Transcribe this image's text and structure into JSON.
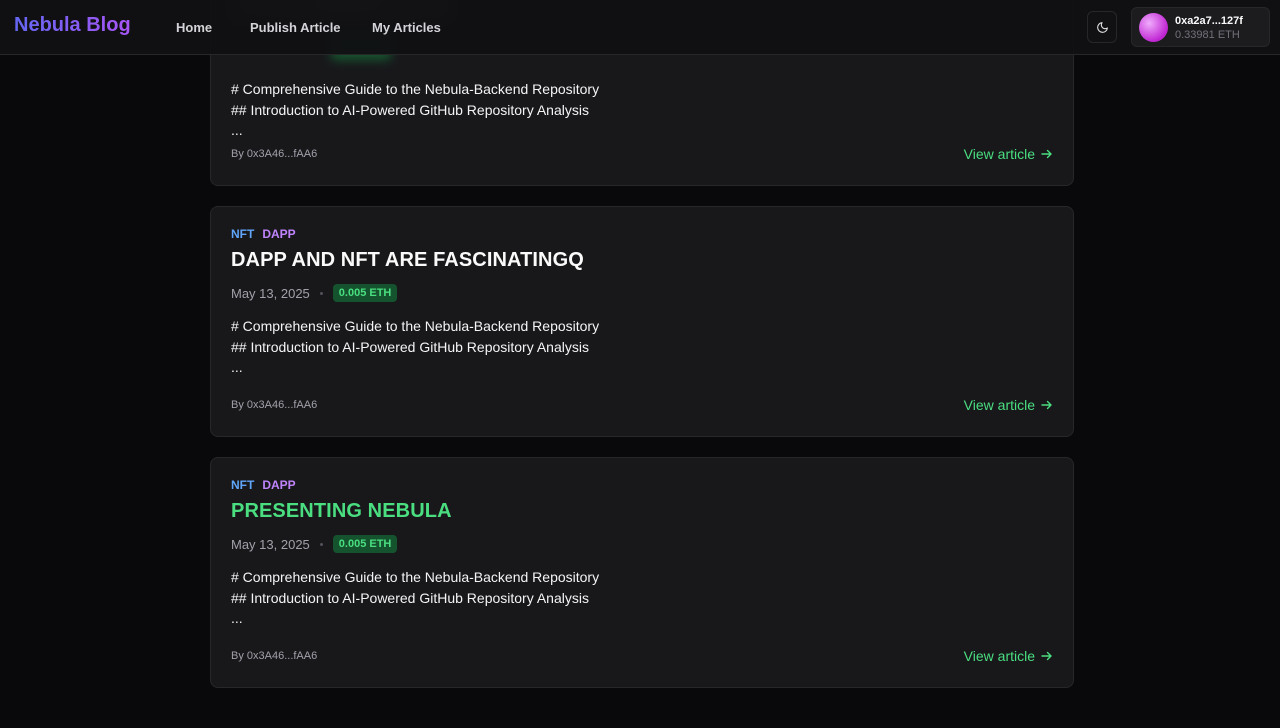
{
  "nav": {
    "logo": "Nebula Blog",
    "links": [
      "Home",
      "Publish Article",
      "My Articles"
    ],
    "wallet": {
      "address": "0xa2a7...127f",
      "balance": "0.33981 ETH"
    }
  },
  "articles": [
    {
      "excerpt": [
        "# Comprehensive Guide to the Nebula-Backend Repository",
        "## Introduction to AI-Powered GitHub Repository Analysis",
        "..."
      ],
      "author": "By 0x3A46...fAA6",
      "cta": "View article"
    },
    {
      "tags": [
        "NFT",
        "DAPP"
      ],
      "title": "DAPP AND NFT ARE FASCINATINGQ",
      "date": "May 13, 2025",
      "price": "0.005 ETH",
      "excerpt": [
        "# Comprehensive Guide to the Nebula-Backend Repository",
        "## Introduction to AI-Powered GitHub Repository Analysis",
        "..."
      ],
      "author": "By 0x3A46...fAA6",
      "cta": "View article"
    },
    {
      "tags": [
        "NFT",
        "DAPP"
      ],
      "title": "PRESENTING NEBULA",
      "date": "May 13, 2025",
      "price": "0.005 ETH",
      "excerpt": [
        "# Comprehensive Guide to the Nebula-Backend Repository",
        "## Introduction to AI-Powered GitHub Repository Analysis",
        "..."
      ],
      "author": "By 0x3A46...fAA6",
      "cta": "View article"
    }
  ]
}
